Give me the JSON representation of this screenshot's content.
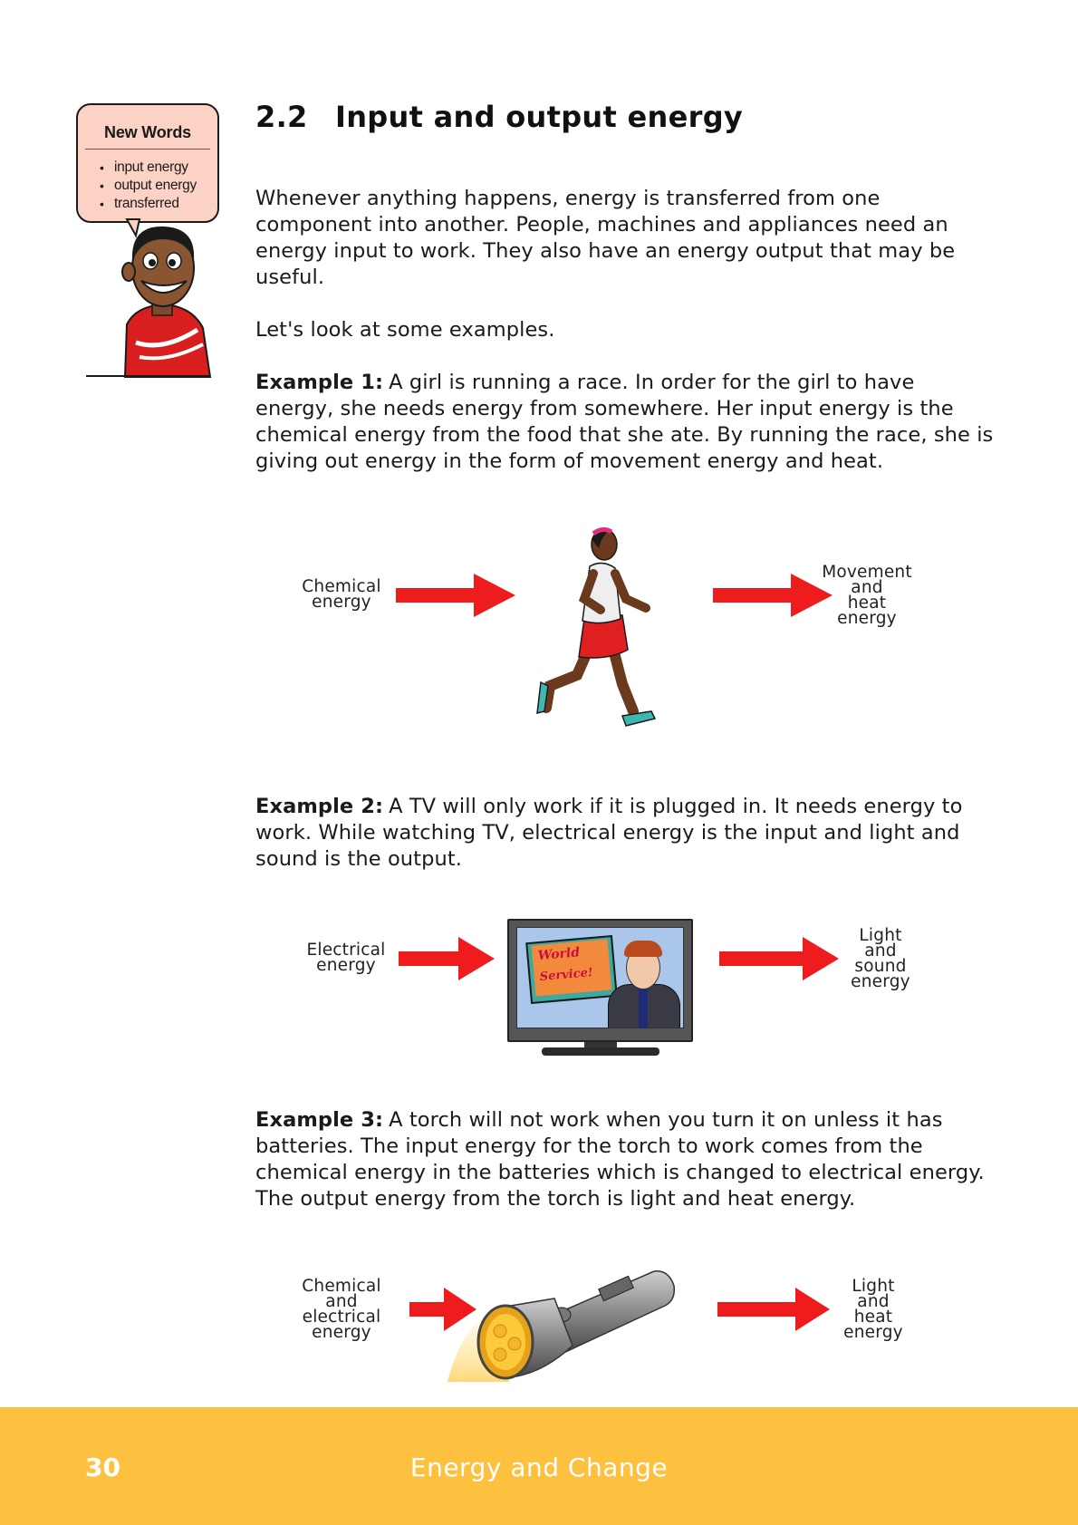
{
  "new_words": {
    "title": "New Words",
    "items": [
      "input energy",
      "output energy",
      "transferred"
    ]
  },
  "heading": {
    "number": "2.2",
    "title": "Input and output energy"
  },
  "intro": "Whenever anything happens, energy is transferred from one component into another. People, machines and appliances need an energy input to work. They also have an energy output that may be useful.",
  "lead": "Let's look at some examples.",
  "examples": [
    {
      "label": "Example 1:",
      "text": "A girl is running a race. In order for the girl to have energy, she needs energy from somewhere. Her input energy is the chemical energy from the food that she ate. By running the race, she is giving out energy in the form of movement energy and heat.",
      "input_lines": [
        "Chemical",
        "energy"
      ],
      "output_lines": [
        "Movement",
        "and",
        "heat",
        "energy"
      ]
    },
    {
      "label": "Example 2:",
      "text": "A TV will only work if it is plugged in. It needs energy to work. While watching TV, electrical energy is the input and light and sound is the output.",
      "input_lines": [
        "Electrical",
        "energy"
      ],
      "output_lines": [
        "Light",
        "and",
        "sound",
        "energy"
      ],
      "screen_text": [
        "World",
        "Service!"
      ]
    },
    {
      "label": "Example 3:",
      "text": "A torch will not work when you turn it on unless it has batteries. The input energy for the torch to work comes from the chemical energy in the batteries which is changed to electrical energy. The output energy from the torch is light and heat energy.",
      "input_lines": [
        "Chemical",
        "and",
        "electrical",
        "energy"
      ],
      "output_lines": [
        "Light",
        "and",
        "heat",
        "energy"
      ]
    }
  ],
  "footer": {
    "page_number": "30",
    "title": "Energy and Change"
  },
  "colors": {
    "arrow": "#ee1c1c",
    "footer": "#fdc140",
    "bubble": "#fcd2c4"
  }
}
